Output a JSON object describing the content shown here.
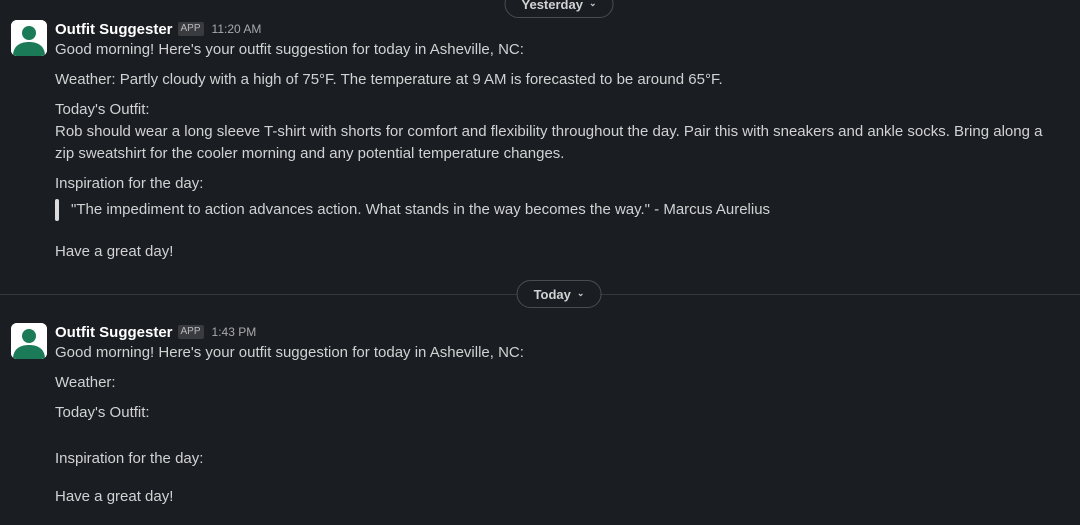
{
  "dividers": {
    "yesterday": "Yesterday",
    "today": "Today"
  },
  "messages": [
    {
      "sender": "Outfit Suggester",
      "badge": "APP",
      "time": "11:20 AM",
      "greeting": "Good morning! Here's your outfit suggestion for today in Asheville, NC:",
      "weather": "Weather: Partly cloudy with a high of 75°F. The temperature at 9 AM is forecasted to be around 65°F.",
      "outfit_heading": "Today's Outfit:",
      "outfit_text": "Rob should wear a long sleeve T-shirt with shorts for comfort and flexibility throughout the day. Pair this with sneakers and ankle socks. Bring along a zip sweatshirt for the cooler morning and any potential temperature changes.",
      "inspiration_heading": "Inspiration for the day:",
      "quote": "\"The impediment to action advances action. What stands in the way becomes the way.\" - Marcus Aurelius",
      "closing": "Have a great day!"
    },
    {
      "sender": "Outfit Suggester",
      "badge": "APP",
      "time": "1:43 PM",
      "greeting": "Good morning! Here's your outfit suggestion for today in Asheville, NC:",
      "weather": "Weather:",
      "outfit_heading": "Today's Outfit:",
      "inspiration_heading": "Inspiration for the day:",
      "closing": "Have a great day!"
    }
  ],
  "colors": {
    "background": "#1a1d21",
    "avatar_green": "#1b7a57",
    "text": "#d1d2d3"
  },
  "icons": {
    "avatar": "bot-avatar-icon",
    "chevron": "chevron-down-icon"
  }
}
